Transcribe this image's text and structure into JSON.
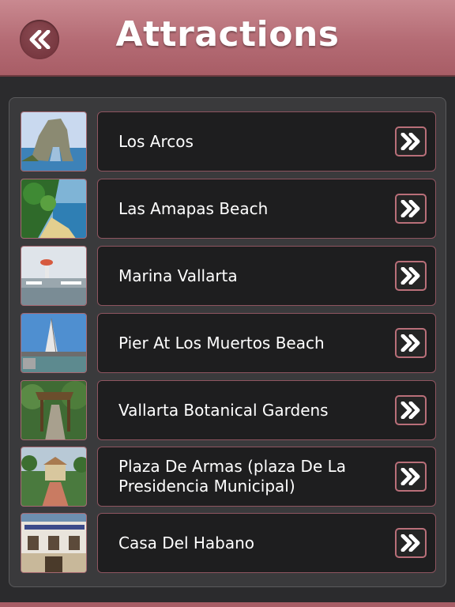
{
  "header": {
    "title": "Attractions",
    "back_icon": "double-chevron-left-icon"
  },
  "attractions": [
    {
      "label": "Los Arcos",
      "thumbnail": "rock-arch-in-sea"
    },
    {
      "label": "Las Amapas Beach",
      "thumbnail": "palm-beach-cove"
    },
    {
      "label": "Marina Vallarta",
      "thumbnail": "marina-lighthouse"
    },
    {
      "label": "Pier At Los Muertos Beach",
      "thumbnail": "pier-sail-structure"
    },
    {
      "label": "Vallarta Botanical Gardens",
      "thumbnail": "garden-bridge"
    },
    {
      "label": "Plaza De Armas (plaza De La Presidencia Municipal)",
      "thumbnail": "town-plaza"
    },
    {
      "label": "Casa Del Habano",
      "thumbnail": "colonial-building"
    }
  ],
  "row_action_icon": "double-chevron-right-icon",
  "colors": {
    "header": "#b46b74",
    "accent_border": "#b96f79",
    "card_background": "#1e1e1f",
    "page_background": "#2b2b2d"
  }
}
